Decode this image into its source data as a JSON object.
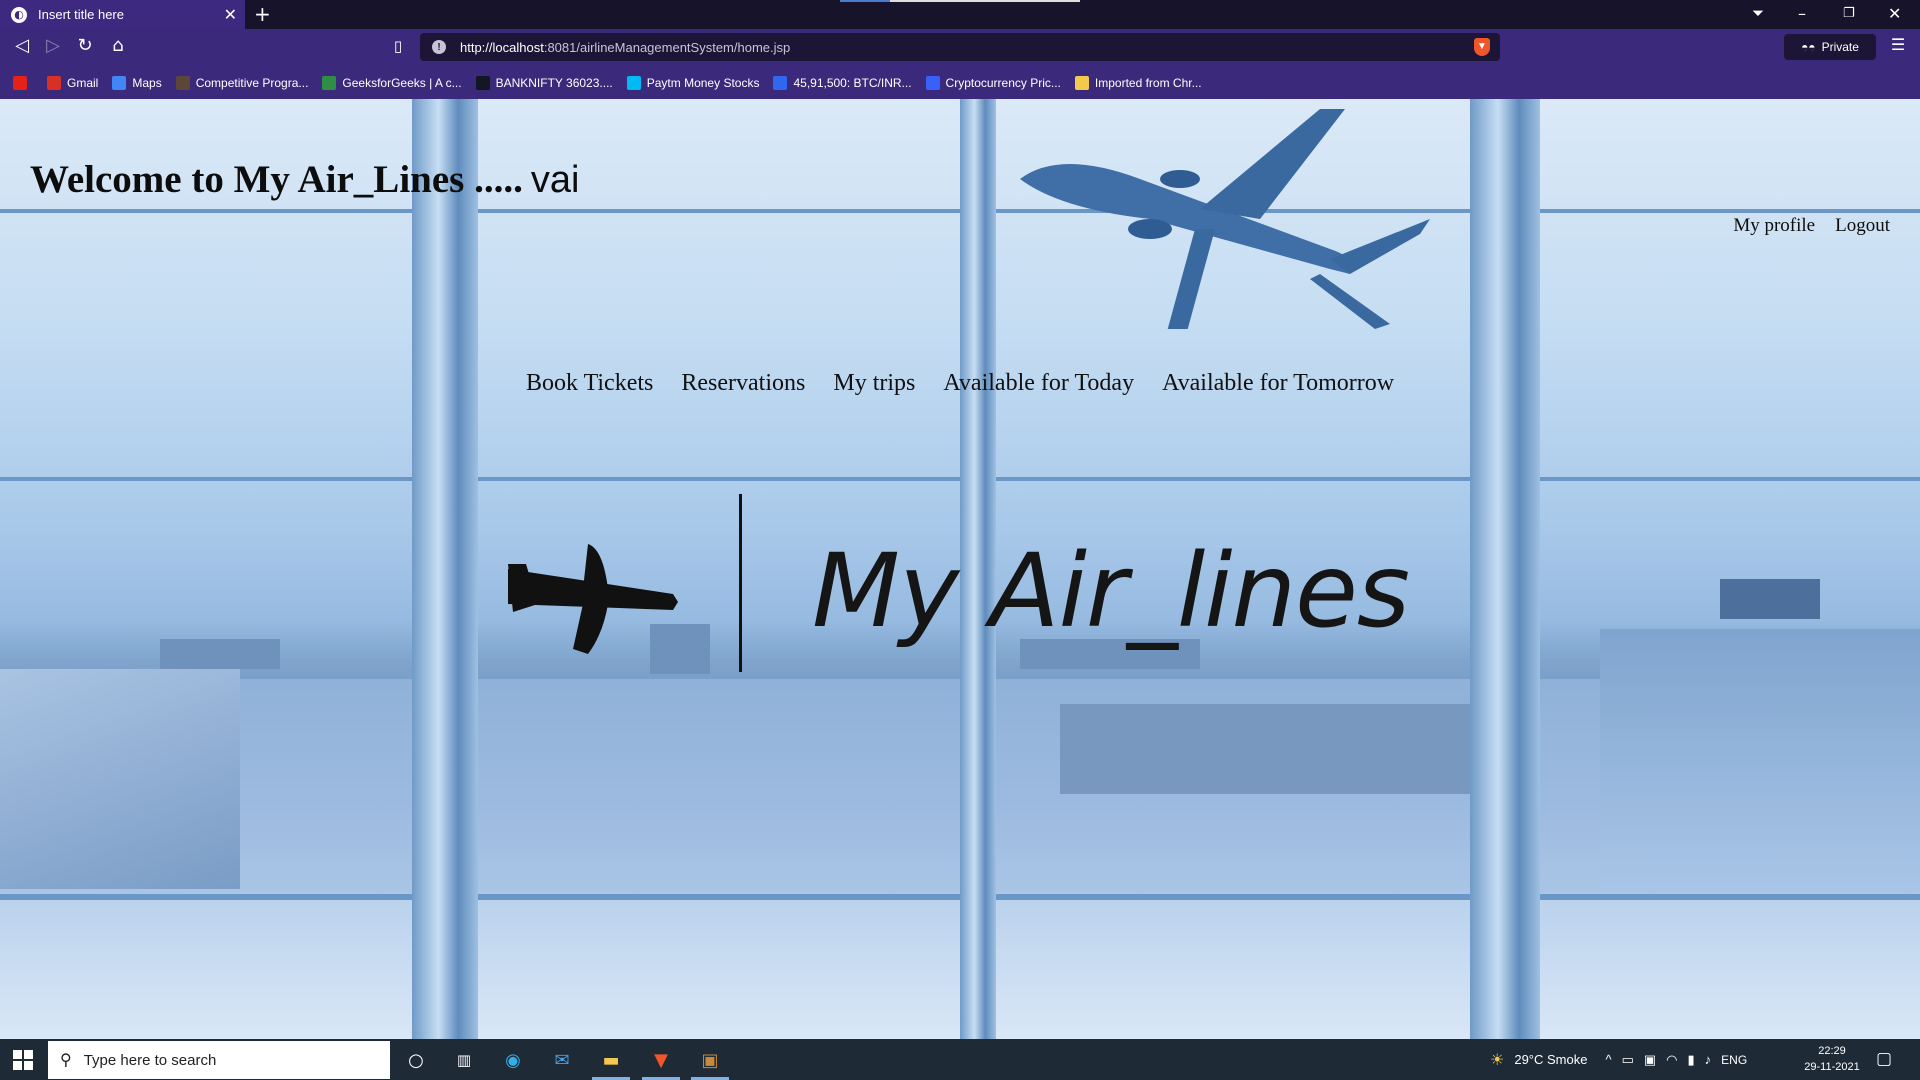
{
  "browser": {
    "tab_title": "Insert title here",
    "url_host": "http://localhost",
    "url_rest": ":8081/airlineManagementSystem/home.jsp",
    "private_label": "Private",
    "bookmarks": [
      {
        "label": "",
        "icon": "youtube-icon",
        "color": "#e62117"
      },
      {
        "label": "Gmail",
        "icon": "gmail-icon",
        "color": "#d93025"
      },
      {
        "label": "Maps",
        "icon": "google-icon",
        "color": "#4285f4"
      },
      {
        "label": "Competitive Progra...",
        "icon": "codechef-icon",
        "color": "#5b4638"
      },
      {
        "label": "GeeksforGeeks | A c...",
        "icon": "gfg-icon",
        "color": "#2f8d46"
      },
      {
        "label": "BANKNIFTY 36023....",
        "icon": "tradingview-icon",
        "color": "#131722"
      },
      {
        "label": "Paytm Money Stocks",
        "icon": "paytm-icon",
        "color": "#00baf2"
      },
      {
        "label": "45,91,500: BTC/INR...",
        "icon": "wazirx-icon",
        "color": "#3067f0"
      },
      {
        "label": "Cryptocurrency Pric...",
        "icon": "coinmarketcap-icon",
        "color": "#3861fb"
      },
      {
        "label": "Imported from Chr...",
        "icon": "folder-icon",
        "color": "#f2c94c"
      }
    ]
  },
  "page": {
    "welcome_text": "Welcome to My Air_Lines .....",
    "username": "vai",
    "top_links": {
      "profile": "My profile",
      "logout": "Logout"
    },
    "nav": [
      "Book Tickets",
      "Reservations",
      "My trips",
      "Available for Today",
      "Available for Tomorrow"
    ],
    "logo_text": "My Air_lines"
  },
  "taskbar": {
    "search_placeholder": "Type here to search",
    "weather": "29°C  Smoke",
    "lang": "ENG",
    "time": "22:29",
    "date": "29-11-2021"
  }
}
